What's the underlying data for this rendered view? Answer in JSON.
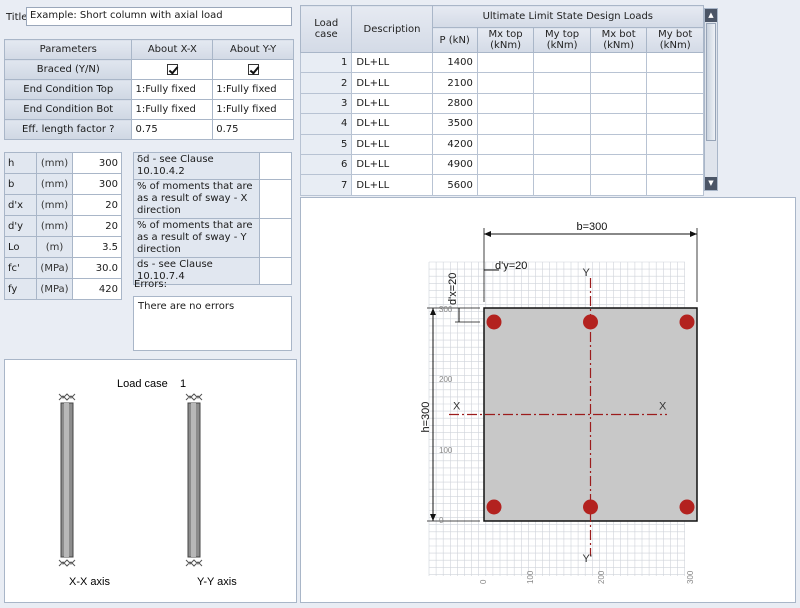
{
  "title": {
    "label": "Title",
    "value": "Example: Short column with axial load"
  },
  "parameters": {
    "headers": [
      "Parameters",
      "About X-X",
      "About Y-Y"
    ],
    "rows": [
      {
        "label": "Braced (Y/N)",
        "xx": "",
        "yy": ""
      },
      {
        "label": "End Condition Top",
        "xx": "1:Fully fixed",
        "yy": "1:Fully fixed"
      },
      {
        "label": "End Condition Bot",
        "xx": "1:Fully fixed",
        "yy": "1:Fully fixed"
      },
      {
        "label": "Eff. length factor ?",
        "xx": "0.75",
        "yy": "0.75"
      }
    ]
  },
  "section": {
    "rows": [
      {
        "name": "h",
        "unit": "(mm)",
        "value": "300"
      },
      {
        "name": "b",
        "unit": "(mm)",
        "value": "300"
      },
      {
        "name": "d'x",
        "unit": "(mm)",
        "value": "20"
      },
      {
        "name": "d'y",
        "unit": "(mm)",
        "value": "20"
      },
      {
        "name": "Lo",
        "unit": "(m)",
        "value": "3.5"
      },
      {
        "name": "fc'",
        "unit": "(MPa)",
        "value": "30.0"
      },
      {
        "name": "fy",
        "unit": "(MPa)",
        "value": "420"
      }
    ]
  },
  "options": {
    "rows": [
      {
        "label": "δd - see Clause 10.10.4.2",
        "value": ""
      },
      {
        "label": "% of moments that are as a result of sway - X direction",
        "value": ""
      },
      {
        "label": "% of moments that are as a result of sway - Y direction",
        "value": ""
      },
      {
        "label": "ds - see Clause 10.10.7.4",
        "value": ""
      }
    ]
  },
  "errors": {
    "label": "Errors:",
    "text": "There are no errors"
  },
  "loads": {
    "header_case": "Load case",
    "header_desc": "Description",
    "header_group": "Ultimate Limit State Design Loads",
    "columns": [
      "P (kN)",
      "Mx top (kNm)",
      "My top (kNm)",
      "Mx bot (kNm)",
      "My bot (kNm)"
    ],
    "rows": [
      {
        "case": "1",
        "desc": "DL+LL",
        "p": "1400"
      },
      {
        "case": "2",
        "desc": "DL+LL",
        "p": "2100"
      },
      {
        "case": "3",
        "desc": "DL+LL",
        "p": "2800"
      },
      {
        "case": "4",
        "desc": "DL+LL",
        "p": "3500"
      },
      {
        "case": "5",
        "desc": "DL+LL",
        "p": "4200"
      },
      {
        "case": "6",
        "desc": "DL+LL",
        "p": "4900"
      },
      {
        "case": "7",
        "desc": "DL+LL",
        "p": "5600"
      }
    ]
  },
  "column_view": {
    "load_case_label": "Load case",
    "load_case_value": "1",
    "xx_axis_label": "X-X axis",
    "yy_axis_label": "Y-Y axis"
  },
  "cross_section": {
    "b_label": "b=300",
    "h_label": "h=300",
    "dy_label": "d'y=20",
    "dx_label": "d'x=20",
    "x_axis_label": "X",
    "y_axis_label": "Y",
    "y_ticks": [
      "300",
      "200",
      "100",
      "0"
    ],
    "x_ticks": [
      "0",
      "100",
      "200",
      "300"
    ],
    "section_fill": "#c8c8c8",
    "bar_color": "#b3221f",
    "axis_color": "#9c1c1c"
  }
}
